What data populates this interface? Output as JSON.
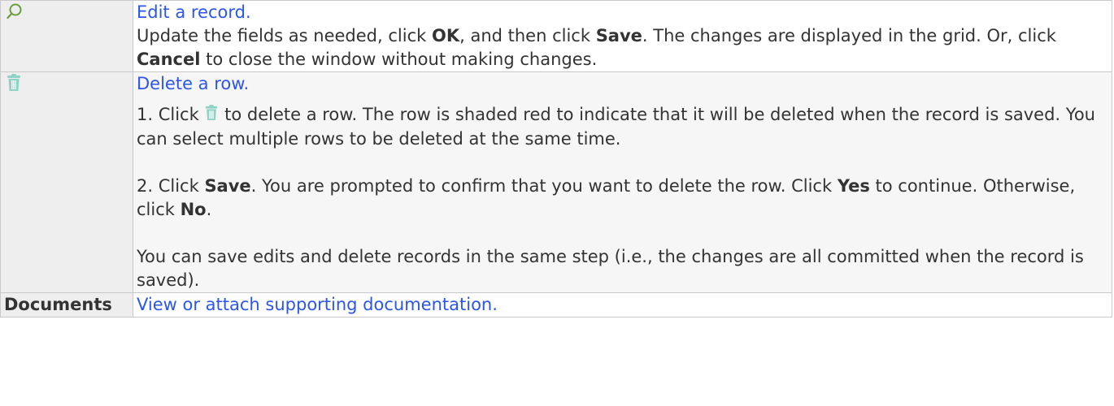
{
  "rows": [
    {
      "key_icon": "search-icon",
      "link": "Edit a record.",
      "text": {
        "p1_a": "Update the fields as needed, click ",
        "p1_b1": "OK",
        "p1_c": ", and then click ",
        "p1_b2": "Save",
        "p1_d": ". The changes are displayed in the grid. Or, click ",
        "p1_b3": "Cancel",
        "p1_e": " to close the window without making changes."
      }
    },
    {
      "key_icon": "trash-icon",
      "link": "Delete a row.",
      "text": {
        "s1_a": "1. Click ",
        "s1_b": " to delete a row. The row is shaded red to indicate that it will be deleted when the record is saved. You can select multiple rows to be deleted at the same time.",
        "s2_a": "2. Click ",
        "s2_b1": "Save",
        "s2_c": ". You are prompted to confirm that you want to delete the row. Click ",
        "s2_b2": "Yes",
        "s2_d": " to continue. Otherwise, click ",
        "s2_b3": "No",
        "s2_e": ".",
        "s3": "You can save edits and delete records in the same step (i.e., the changes are all committed when the record is saved)."
      }
    },
    {
      "key_label": "Documents",
      "link": "View or attach supporting documentation."
    }
  ],
  "colors": {
    "link": "#2b55ee",
    "key_bg": "#eeeeee",
    "border": "#c9c9c9",
    "search_icon": "#6a9e3a",
    "trash_icon": "#8fd3c4"
  }
}
